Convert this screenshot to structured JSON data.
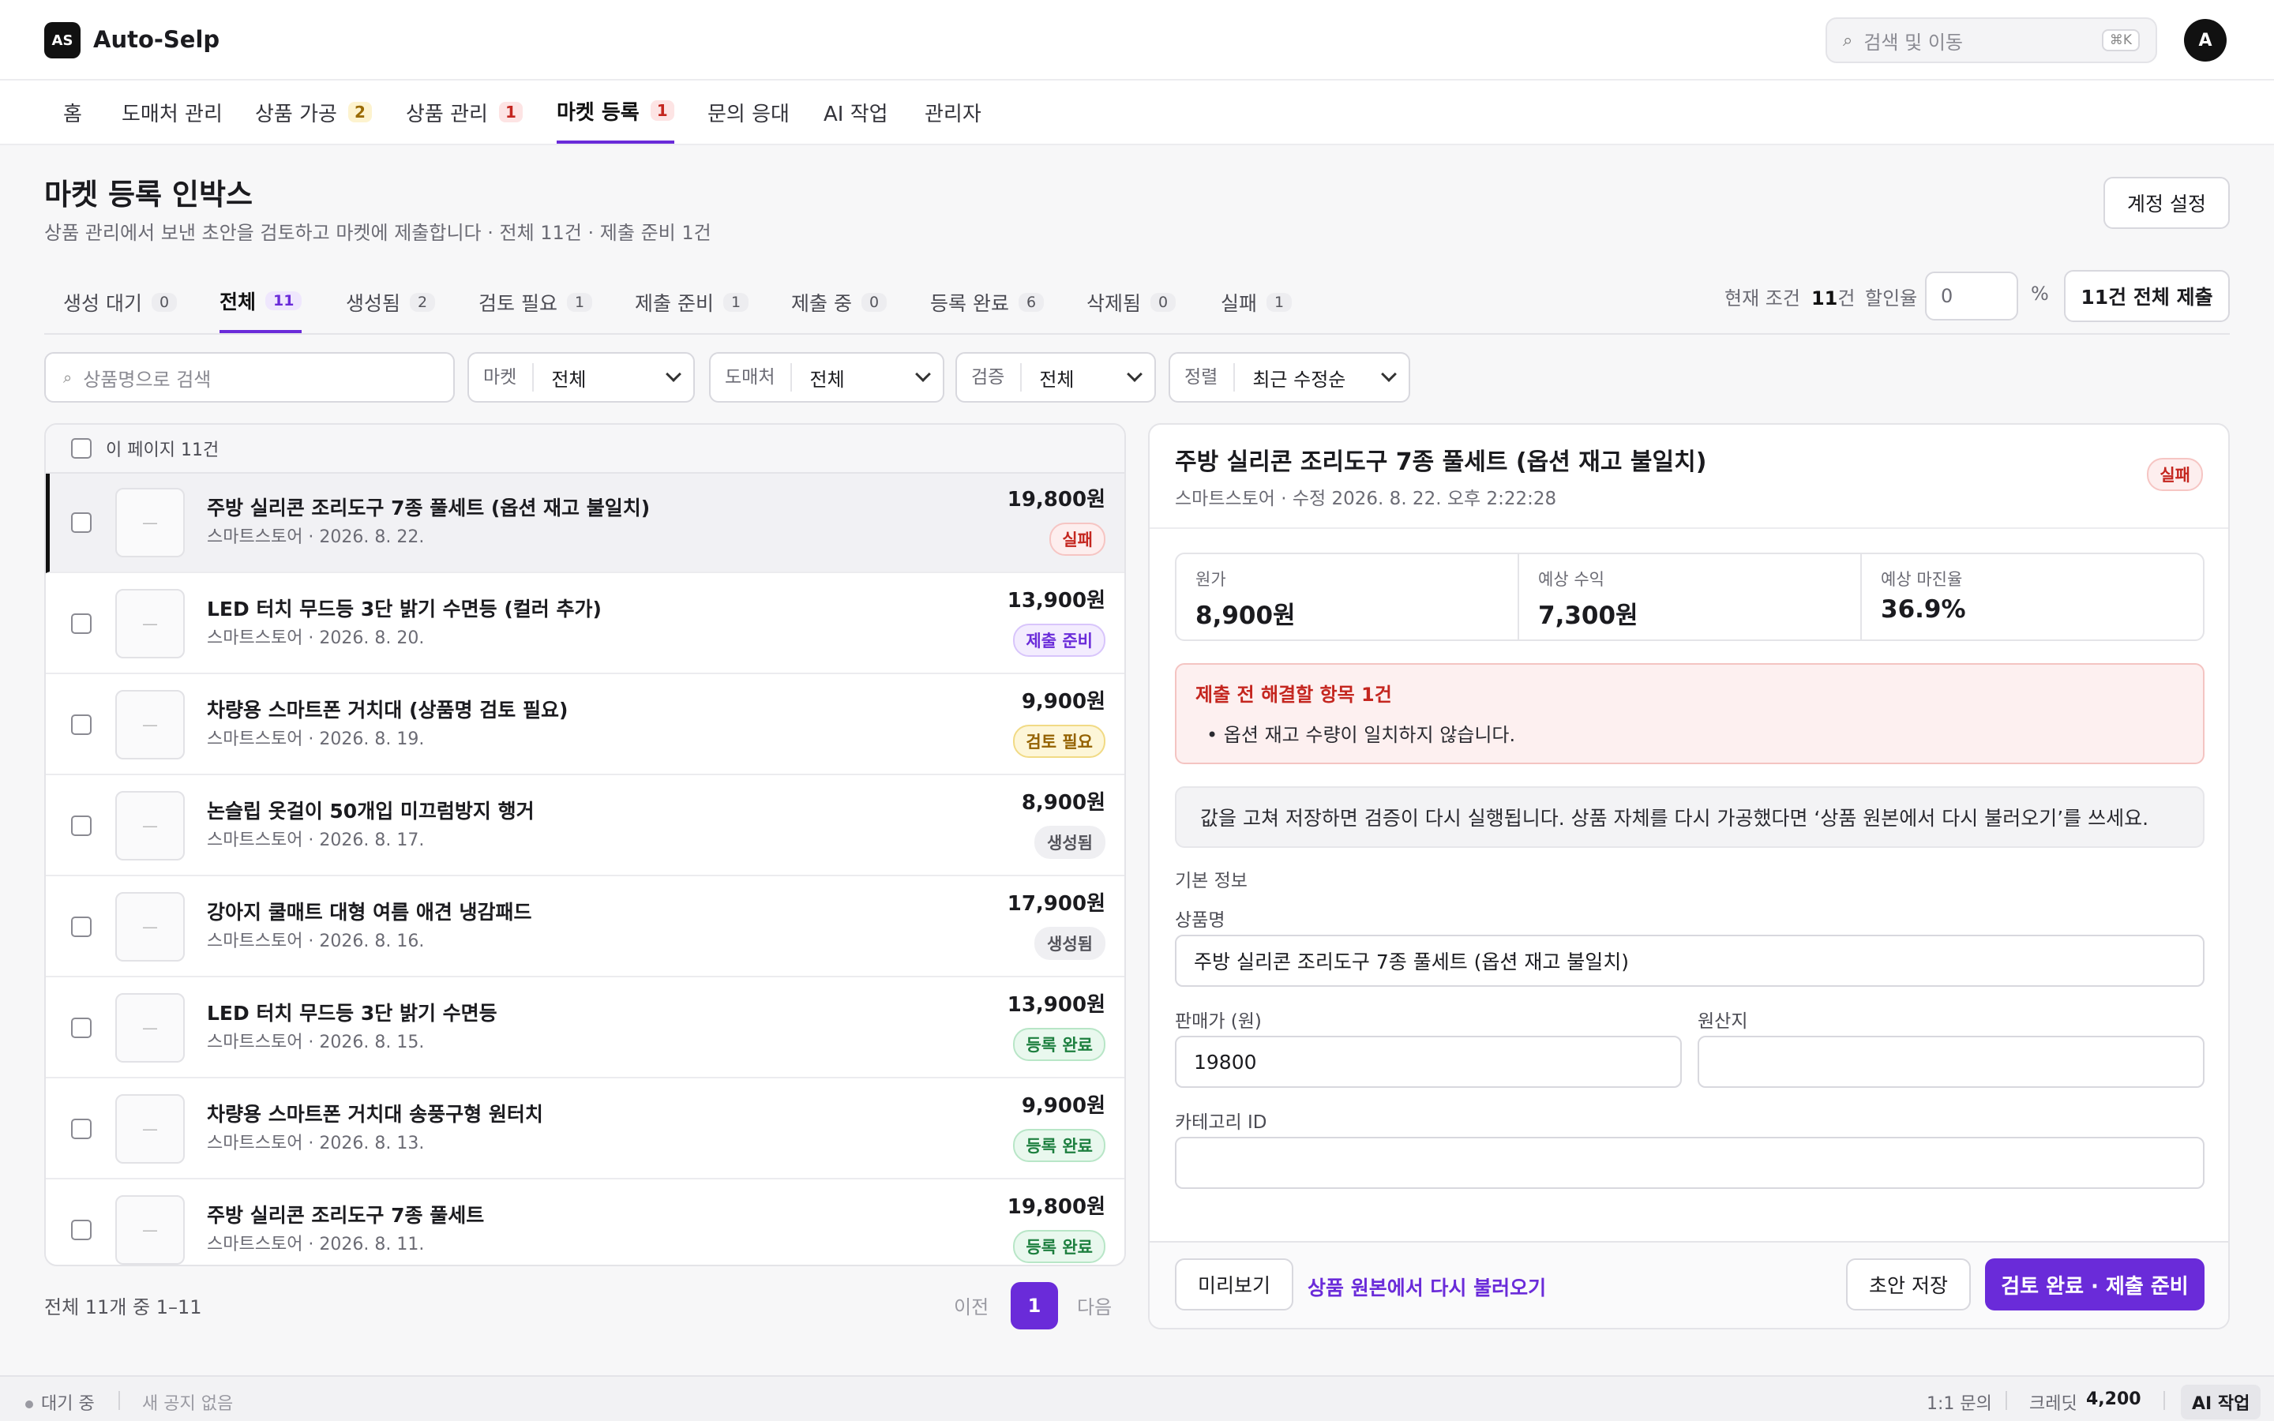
{
  "app": {
    "logo": "AS",
    "name": "Auto-Selp",
    "avatar": "A"
  },
  "search": {
    "placeholder": "검색 및 이동",
    "shortcut": "⌘K",
    "icon": "search-icon"
  },
  "nav": {
    "home": "홈",
    "supplier": "도매처 관리",
    "processing": "상품 가공",
    "processing_badge": "2",
    "products": "상품 관리",
    "products_badge": "1",
    "market": "마켓 등록",
    "market_badge": "1",
    "inquiry": "문의 응대",
    "ai": "AI 작업",
    "admin": "관리자"
  },
  "page": {
    "title": "마켓 등록 인박스",
    "subtitle": "상품 관리에서 보낸 초안을 검토하고 마켓에 제출합니다 · 전체 11건 · 제출 준비 1건",
    "account_button": "계정 설정"
  },
  "tabs": [
    {
      "label": "생성 대기",
      "count": "0"
    },
    {
      "label": "전체",
      "count": "11"
    },
    {
      "label": "생성됨",
      "count": "2"
    },
    {
      "label": "검토 필요",
      "count": "1"
    },
    {
      "label": "제출 준비",
      "count": "1"
    },
    {
      "label": "제출 중",
      "count": "0"
    },
    {
      "label": "등록 완료",
      "count": "6"
    },
    {
      "label": "삭제됨",
      "count": "0"
    },
    {
      "label": "실패",
      "count": "1"
    }
  ],
  "bulk": {
    "condition_label": "현재 조건",
    "condition_count": "11",
    "condition_unit": "건",
    "discount_label": "할인율",
    "discount_value": "0",
    "percent": "%",
    "submit_all": "11건 전체 제출"
  },
  "filters": {
    "search_placeholder": "상품명으로 검색",
    "market_label": "마켓",
    "market_value": "전체",
    "supplier_label": "도매처",
    "supplier_value": "전체",
    "validation_label": "검증",
    "validation_value": "전체",
    "sort_label": "정렬",
    "sort_value": "최근 수정순"
  },
  "list": {
    "header": "이 페이지 11건",
    "thumb_placeholder": "—",
    "rows": [
      {
        "name": "주방 실리콘 조리도구 7종 풀세트 (옵션 재고 불일치)",
        "meta": "스마트스토어 · 2026. 8. 22.",
        "price": "19,800원",
        "status": "실패"
      },
      {
        "name": "LED 터치 무드등 3단 밝기 수면등 (컬러 추가)",
        "meta": "스마트스토어 · 2026. 8. 20.",
        "price": "13,900원",
        "status": "제출 준비"
      },
      {
        "name": "차량용 스마트폰 거치대 (상품명 검토 필요)",
        "meta": "스마트스토어 · 2026. 8. 19.",
        "price": "9,900원",
        "status": "검토 필요"
      },
      {
        "name": "논슬립 옷걸이 50개입 미끄럼방지 행거",
        "meta": "스마트스토어 · 2026. 8. 17.",
        "price": "8,900원",
        "status": "생성됨"
      },
      {
        "name": "강아지 쿨매트 대형 여름 애견 냉감패드",
        "meta": "스마트스토어 · 2026. 8. 16.",
        "price": "17,900원",
        "status": "생성됨"
      },
      {
        "name": "LED 터치 무드등 3단 밝기 수면등",
        "meta": "스마트스토어 · 2026. 8. 15.",
        "price": "13,900원",
        "status": "등록 완료"
      },
      {
        "name": "차량용 스마트폰 거치대 송풍구형 원터치",
        "meta": "스마트스토어 · 2026. 8. 13.",
        "price": "9,900원",
        "status": "등록 완료"
      },
      {
        "name": "주방 실리콘 조리도구 7종 풀세트",
        "meta": "스마트스토어 · 2026. 8. 11.",
        "price": "19,800원",
        "status": "등록 완료"
      }
    ]
  },
  "pagination": {
    "info": "전체 11개 중 1–11",
    "prev": "이전",
    "current": "1",
    "next": "다음"
  },
  "detail": {
    "title": "주방 실리콘 조리도구 7종 풀세트 (옵션 재고 불일치)",
    "meta": "스마트스토어 · 수정 2026. 8. 22. 오후 2:22:28",
    "status": "실패",
    "stats": [
      {
        "label": "원가",
        "value": "8,900원"
      },
      {
        "label": "예상 수익",
        "value": "7,300원"
      },
      {
        "label": "예상 마진율",
        "value": "36.9%"
      }
    ],
    "alert_title": "제출 전 해결할 항목 1건",
    "alert_item": "옵션 재고 수량이 일치하지 않습니다.",
    "note": "값을 고쳐 저장하면 검증이 다시 실행됩니다. 상품 자체를 다시 가공했다면 ‘상품 원본에서 다시 불러오기’를 쓰세요.",
    "section": "기본 정보",
    "name_label": "상품명",
    "name_value": "주방 실리콘 조리도구 7종 풀세트 (옵션 재고 불일치)",
    "price_label": "판매가 (원)",
    "price_value": "19800",
    "origin_label": "원산지",
    "origin_value": "",
    "category_label": "카테고리 ID",
    "category_value": "",
    "preview": "미리보기",
    "reload": "상품 원본에서 다시 불러오기",
    "save_draft": "초안 저장",
    "complete": "검토 완료 · 제출 준비"
  },
  "statusbar": {
    "state": "대기 중",
    "notice": "새 공지 없음",
    "inquiry": "1:1 문의",
    "credit_label": "크레딧",
    "credit_value": "4,200",
    "ai": "AI 작업"
  },
  "colors": {
    "accent": "#6a2bd9",
    "fail": "#c4261f",
    "done": "#1d7f3f",
    "review": "#946200"
  }
}
